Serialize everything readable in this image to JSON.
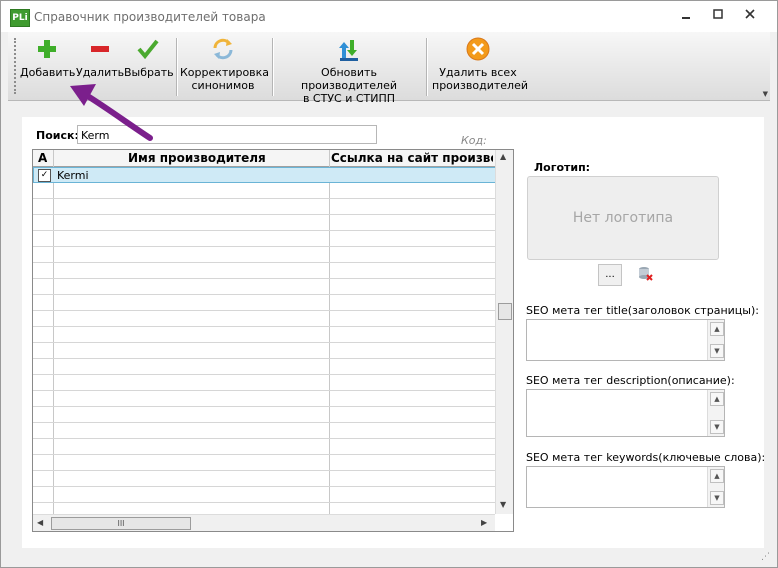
{
  "window": {
    "title": "Справочник производителей товара",
    "app_icon_text": "PLi"
  },
  "toolbar": {
    "add_label": "Добавить",
    "delete_label": "Удалить",
    "select_label": "Выбрать",
    "synonyms_label_1": "Корректировка",
    "synonyms_label_2": "синонимов",
    "update_label_1": "Обновить производителей",
    "update_label_2": "в СТУС и СТИПП",
    "delete_all_label_1": "Удалить всех",
    "delete_all_label_2": "производителей"
  },
  "search": {
    "label": "Поиск:",
    "value": "Kerm",
    "code_label": "Код:"
  },
  "grid": {
    "columns": [
      "A",
      "Имя производителя",
      "Ссылка на сайт производителя"
    ],
    "rows": [
      {
        "checked": true,
        "name": "Kermi",
        "link": ""
      }
    ],
    "scroll_thumb": "III"
  },
  "logo": {
    "label": "Логотип:",
    "placeholder": "Нет логотипа",
    "browse_label": "..."
  },
  "seo": {
    "title_label": "SEO мета тег title(заголовок страницы):",
    "description_label": "SEO мета тег description(описание):",
    "keywords_label": "SEO мета тег keywords(ключевые слова):"
  },
  "colors": {
    "accent_arrow": "#7b1f8c",
    "selected_row": "#cfeaf6"
  }
}
